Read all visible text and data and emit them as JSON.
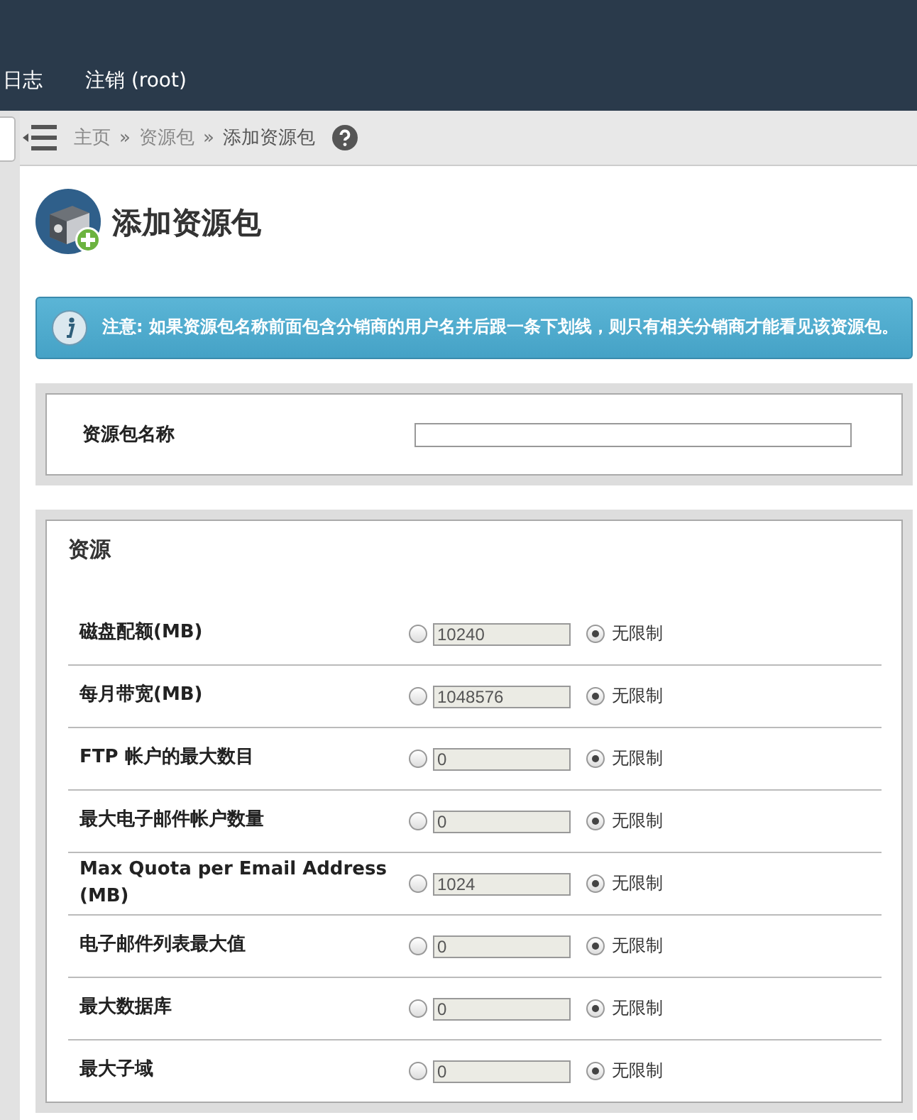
{
  "top_nav": [
    "日志",
    "注销 (root)"
  ],
  "breadcrumb": {
    "items": [
      "主页",
      "资源包",
      "添加资源包"
    ],
    "separator": "»"
  },
  "page_title": "添加资源包",
  "alert": {
    "text": "注意: 如果资源包名称前面包含分销商的用户名并后跟一条下划线，则只有相关分销商才能看见该资源包。"
  },
  "name_field": {
    "label": "资源包名称"
  },
  "resources": {
    "heading": "资源",
    "rows": [
      {
        "label": "磁盘配额(MB)",
        "value": "10240",
        "unlimited": true,
        "unlimited_label": "无限制"
      },
      {
        "label": "每月带宽(MB)",
        "value": "1048576",
        "unlimited": true,
        "unlimited_label": "无限制"
      },
      {
        "label": "FTP 帐户的最大数目",
        "value": "0",
        "unlimited": true,
        "unlimited_label": "无限制"
      },
      {
        "label": "最大电子邮件帐户数量",
        "value": "0",
        "unlimited": true,
        "unlimited_label": "无限制"
      },
      {
        "label": "Max Quota per Email Address (MB)",
        "value": "1024",
        "unlimited": true,
        "unlimited_label": "无限制"
      },
      {
        "label": "电子邮件列表最大值",
        "value": "0",
        "unlimited": true,
        "unlimited_label": "无限制"
      },
      {
        "label": "最大数据库",
        "value": "0",
        "unlimited": true,
        "unlimited_label": "无限制"
      },
      {
        "label": "最大子域",
        "value": "0",
        "unlimited": true,
        "unlimited_label": "无限制"
      }
    ]
  }
}
